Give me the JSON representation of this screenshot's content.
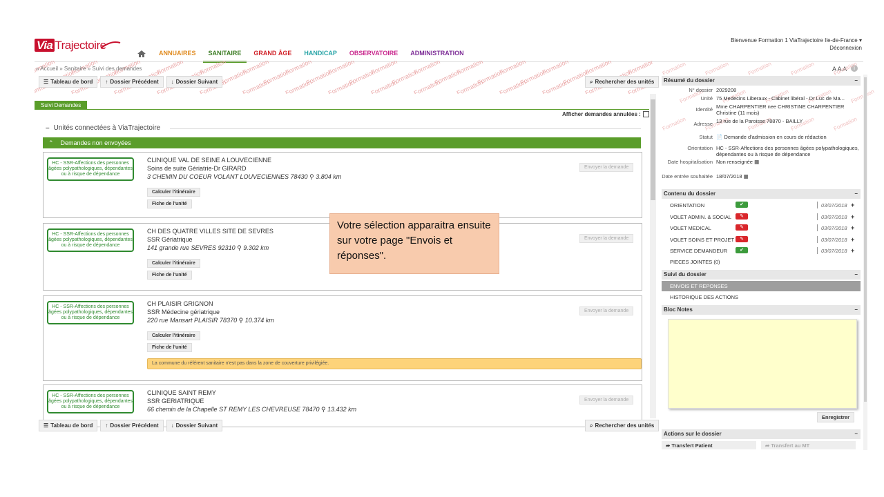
{
  "header": {
    "logo_text": "ViaTrajectoire",
    "logo_via": "Via",
    "logo_rest": "Trajectoire",
    "nav": [
      {
        "label": "ANNUAIRES",
        "color": "#e08a1e"
      },
      {
        "label": "SANITAIRE",
        "color": "#3d7d25",
        "active": true
      },
      {
        "label": "GRAND ÂGE",
        "color": "#d02027"
      },
      {
        "label": "HANDICAP",
        "color": "#2aa5a8"
      },
      {
        "label": "OBSERVATOIRE",
        "color": "#c8268c"
      },
      {
        "label": "ADMINISTRATION",
        "color": "#7b2a95"
      }
    ],
    "welcome": "Bienvenue Formation 1 ViaTrajectoire Ile-de-France",
    "logout": "Déconnexion",
    "text_size": "A A A"
  },
  "breadcrumb": "» Accueil » Sanitaire » Suivi des demandes",
  "watermark": "Formation",
  "toolbar": {
    "dashboard": "Tableau de bord",
    "previous": "Dossier Précédent",
    "next": "Dossier Suivant",
    "search_units": "Rechercher des unités"
  },
  "main": {
    "tab": "Suivi Demandes",
    "show_cancelled": "Afficher demandes annulées :",
    "section_title": "Unités connectées à ViaTrajectoire",
    "group_title": "Demandes non envoyées",
    "send_label": "Envoyer la demande",
    "itinerary_label": "Calculer l'itinéraire",
    "unit_sheet_label": "Fiche de l'unité",
    "cards": [
      {
        "badge": "HC - SSR-Affections des personnes âgées polypathologiques, dépendantes ou à risque de dépendance",
        "name": "CLINIQUE VAL DE SEINE A LOUVECIENNE",
        "sub": "Soins de suite Gériatrie-Dr GIRARD",
        "address": "3 CHEMIN DU COEUR VOLANT LOUVECIENNES 78430",
        "distance": "3.804 km"
      },
      {
        "badge": "HC - SSR-Affections des personnes âgées polypathologiques, dépendantes ou à risque de dépendance",
        "name": "CH DES QUATRE VILLES SITE DE SEVRES",
        "sub": "SSR Gériatrique",
        "address": "141 grande rue SEVRES 92310",
        "distance": "9.302 km"
      },
      {
        "badge": "HC - SSR-Affections des personnes âgées polypathologiques, dépendantes ou à risque de dépendance",
        "name": "CH PLAISIR GRIGNON",
        "sub": "SSR Médecine gériatrique",
        "address": "220 rue Mansart PLAISIR 78370",
        "distance": "10.374 km",
        "warning": "La commune du référent sanitaire n'est pas dans la zone de couverture privilégiée."
      },
      {
        "badge": "HC - SSR-Affections des personnes âgées polypathologiques, dépendantes ou à risque de dépendance",
        "name": "CLINIQUE SAINT REMY",
        "sub": "SSR GERIATRIQUE",
        "address": "66 chemin de la Chapelle ST REMY LES CHEVREUSE 78470",
        "distance": "13.432 km"
      }
    ]
  },
  "callout": {
    "text": "Votre sélection apparaitra ensuite sur votre page \"Envois et réponses\".",
    "background": "#f8cbad"
  },
  "summary": {
    "title": "Résumé du dossier",
    "rows": [
      {
        "label": "N° dossier",
        "value": "2029208"
      },
      {
        "label": "Unité",
        "value": "75 Medecins Liberaux - Cabinet libéral - Dr Luc de Ma..."
      },
      {
        "label": "Identité",
        "value": "Mme CHARPENTIER nee CHRISTINE CHARPENTIER Christine (11 mois)"
      },
      {
        "label": "Adresse",
        "value": "13 rue de la Paroisse 78870 - BAILLY"
      },
      {
        "label": "Statut",
        "value": "Demande d'admission en cours de rédaction"
      },
      {
        "label": "Orientation",
        "value": "HC - SSR-Affections des personnes âgées polypathologiques, dépendantes ou à risque de dépendance"
      },
      {
        "label": "Date hospitalisation",
        "value": "Non renseignée"
      },
      {
        "label": "Date entrée souhaitée",
        "value": "18/07/2018"
      }
    ]
  },
  "content": {
    "title": "Contenu du dossier",
    "items": [
      {
        "label": "ORIENTATION",
        "status": "ok",
        "date": "03/07/2018"
      },
      {
        "label": "VOLET ADMIN. & SOCIAL",
        "status": "ko",
        "date": "03/07/2018"
      },
      {
        "label": "VOLET MEDICAL",
        "status": "ko",
        "date": "03/07/2018"
      },
      {
        "label": "VOLET SOINS ET PROJET",
        "status": "ko",
        "date": "03/07/2018"
      },
      {
        "label": "SERVICE DEMANDEUR",
        "status": "ok",
        "date": "03/07/2018"
      }
    ],
    "attachments": "PIECES JOINTES (0)"
  },
  "followup": {
    "title": "Suivi du dossier",
    "items": [
      "ENVOIS ET REPONSES",
      "HISTORIQUE DES ACTIONS"
    ]
  },
  "notes": {
    "title": "Bloc Notes",
    "save": "Enregistrer"
  },
  "actions": {
    "title": "Actions sur le dossier",
    "transfer_patient": "Transfert Patient",
    "transfer_mt": "Transfert au MT"
  }
}
